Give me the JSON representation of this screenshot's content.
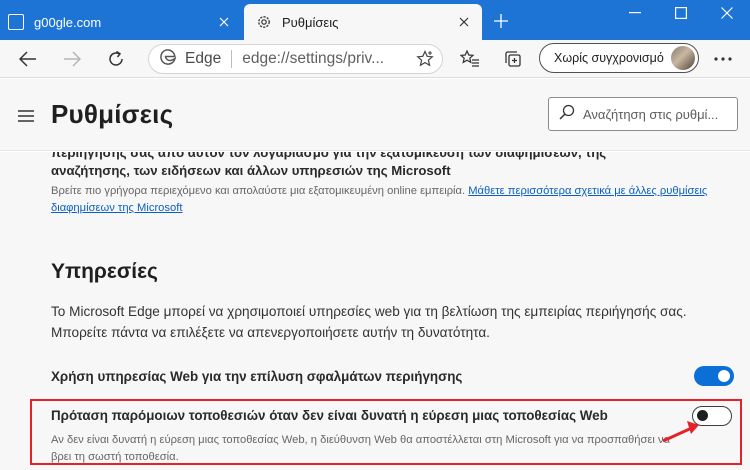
{
  "tabs": [
    {
      "label": "g00gle.com",
      "active": false
    },
    {
      "label": "Ρυθμίσεις",
      "active": true
    }
  ],
  "toolbar": {
    "address_brand": "Edge",
    "url_scheme": "edge://",
    "url_rest": "settings/priv...",
    "sync_label": "Χωρίς συγχρονισμό"
  },
  "header": {
    "title": "Ρυθμίσεις",
    "search_placeholder": "Αναζήτηση στις ρυθμί..."
  },
  "content": {
    "cut_line_1": "περιήγησης σας από αυτόν τον λογαριασμό για την εξατομίκευση των διαφημίσεων, της",
    "cut_line_2": "αναζήτησης, των ειδήσεων και άλλων υπηρεσιών της Microsoft",
    "personalize_desc": "Βρείτε πιο γρήγορα περιεχόμενο και απολαύστε μια εξατομικευμένη online εμπειρία.",
    "learn_more_link": "Μάθετε περισσότερα σχετικά με άλλες ρυθμίσεις διαφημίσεων της Microsoft",
    "section_title": "Υπηρεσίες",
    "section_desc": "Το Microsoft Edge μπορεί να χρησιμοποιεί υπηρεσίες web για τη βελτίωση της εμπειρίας περιήγησής σας. Μπορείτε πάντα να επιλέξετε να απενεργοποιήσετε αυτήν τη δυνατότητα.",
    "settings": [
      {
        "label": "Χρήση υπηρεσίας Web για την επίλυση σφαλμάτων περιήγησης",
        "enabled": true
      },
      {
        "label": "Πρόταση παρόμοιων τοποθεσιών όταν δεν είναι δυνατή η εύρεση μιας τοποθεσίας Web",
        "description": "Αν δεν είναι δυνατή η εύρεση μιας τοποθεσίας Web, η διεύθυνση Web θα αποστέλλεται στη Microsoft για να προσπαθήσει να βρει τη σωστή τοποθεσία.",
        "enabled": false
      }
    ]
  },
  "colors": {
    "titlebar": "#1e74d4",
    "accent": "#0b6fd6",
    "highlight": "#e5212a"
  }
}
